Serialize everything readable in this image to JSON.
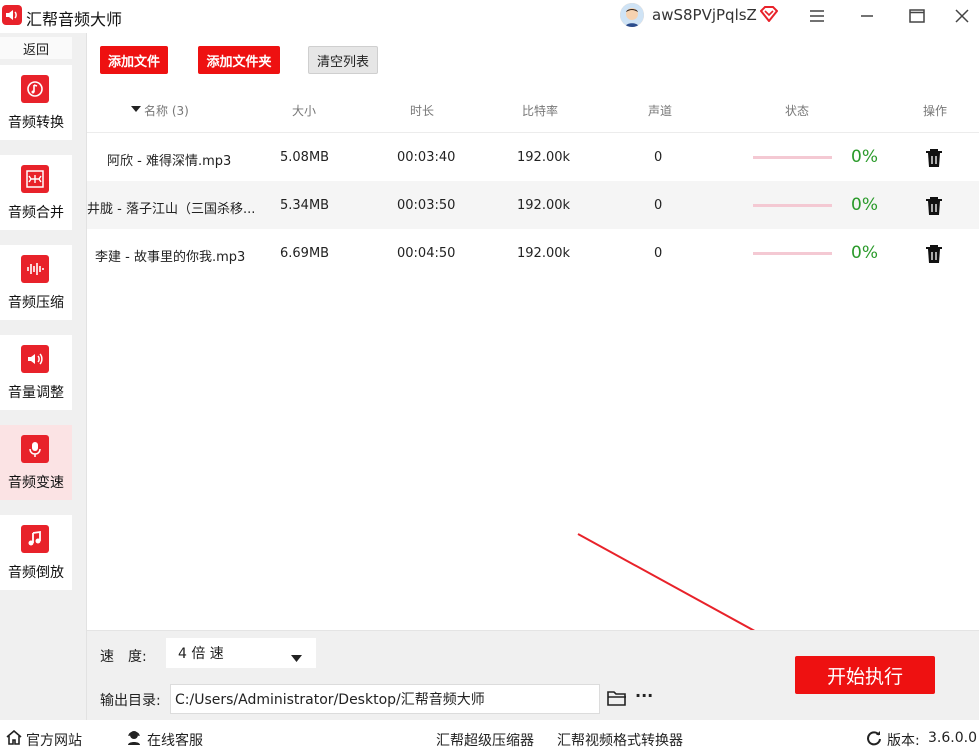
{
  "app": {
    "title": "汇帮音频大师",
    "username": "awS8PVjPqlsZ"
  },
  "sidebar": {
    "back_label": "返回",
    "items": [
      {
        "label": "音频转换",
        "icon": "audio-convert-icon"
      },
      {
        "label": "音频合并",
        "icon": "audio-merge-icon"
      },
      {
        "label": "音频压缩",
        "icon": "audio-compress-icon"
      },
      {
        "label": "音量调整",
        "icon": "volume-icon"
      },
      {
        "label": "音频变速",
        "icon": "microphone-icon"
      },
      {
        "label": "音频倒放",
        "icon": "music-note-icon"
      }
    ]
  },
  "toolbar": {
    "add_file": "添加文件",
    "add_folder": "添加文件夹",
    "clear_list": "清空列表"
  },
  "table": {
    "headers": {
      "name": "名称 (3)",
      "size": "大小",
      "duration": "时长",
      "bitrate": "比特率",
      "channel": "声道",
      "status": "状态",
      "action": "操作"
    },
    "rows": [
      {
        "name": "阿欣 - 难得深情.mp3",
        "size": "5.08MB",
        "duration": "00:03:40",
        "bitrate": "192.00k",
        "channel": "0",
        "percent": "0%"
      },
      {
        "name": "井胧 - 落子江山（三国杀移...",
        "size": "5.34MB",
        "duration": "00:03:50",
        "bitrate": "192.00k",
        "channel": "0",
        "percent": "0%"
      },
      {
        "name": "李建 - 故事里的你我.mp3",
        "size": "6.69MB",
        "duration": "00:04:50",
        "bitrate": "192.00k",
        "channel": "0",
        "percent": "0%"
      }
    ]
  },
  "settings": {
    "speed_label": "速　度:",
    "speed_value": "4 倍 速",
    "output_label": "输出目录:",
    "output_path": "C:/Users/Administrator/Desktop/汇帮音频大师",
    "more": "···"
  },
  "actions": {
    "start": "开始执行"
  },
  "footer": {
    "website": "官方网站",
    "support": "在线客服",
    "compressor": "汇帮超级压缩器",
    "converter": "汇帮视频格式转换器",
    "version_label": "版本:",
    "version": "3.6.0.0"
  },
  "colors": {
    "accent": "#ee1111",
    "progress_text": "#2a9a2a",
    "progress_bar": "#f4c9d3"
  }
}
